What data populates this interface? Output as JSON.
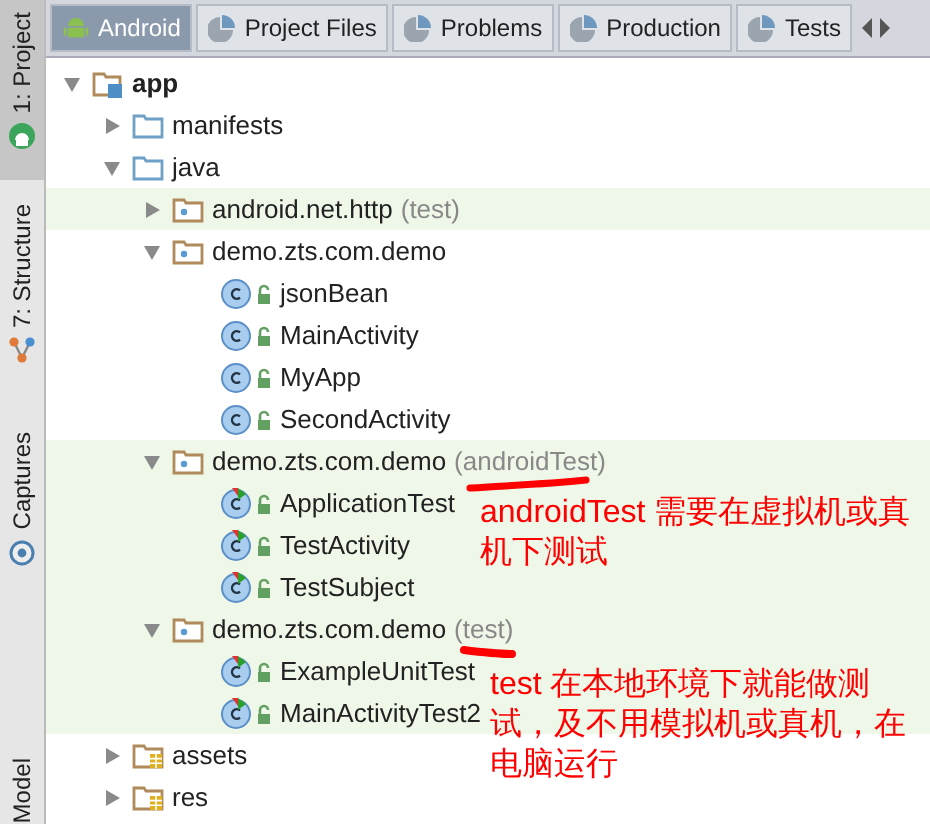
{
  "side_tools": [
    {
      "label": "1: Project",
      "selected": true
    },
    {
      "label": "7: Structure",
      "selected": false
    },
    {
      "label": "Captures",
      "selected": false
    },
    {
      "label": "Model",
      "selected": false
    }
  ],
  "tabs": [
    {
      "label": "Android",
      "selected": true
    },
    {
      "label": "Project Files",
      "selected": false
    },
    {
      "label": "Problems",
      "selected": false
    },
    {
      "label": "Production",
      "selected": false
    },
    {
      "label": "Tests",
      "selected": false
    }
  ],
  "tree": [
    {
      "label": "app",
      "kind": "module",
      "expanded": true,
      "children": [
        {
          "label": "manifests",
          "kind": "folder",
          "expanded": false
        },
        {
          "label": "java",
          "kind": "folder",
          "expanded": true,
          "children": [
            {
              "label": "android.net.http",
              "suffix": "(test)",
              "kind": "package",
              "expanded": false,
              "highlighted": true
            },
            {
              "label": "demo.zts.com.demo",
              "kind": "package",
              "expanded": true,
              "highlighted": false,
              "children": [
                {
                  "label": "jsonBean",
                  "kind": "class"
                },
                {
                  "label": "MainActivity",
                  "kind": "class"
                },
                {
                  "label": "MyApp",
                  "kind": "class"
                },
                {
                  "label": "SecondActivity",
                  "kind": "class"
                }
              ]
            },
            {
              "label": "demo.zts.com.demo",
              "suffix": "(androidTest)",
              "kind": "package",
              "expanded": true,
              "highlighted": true,
              "children": [
                {
                  "label": "ApplicationTest",
                  "kind": "test_class"
                },
                {
                  "label": "TestActivity",
                  "kind": "test_class"
                },
                {
                  "label": "TestSubject",
                  "kind": "test_class"
                }
              ]
            },
            {
              "label": "demo.zts.com.demo",
              "suffix": "(test)",
              "kind": "package",
              "expanded": true,
              "highlighted": true,
              "children": [
                {
                  "label": "ExampleUnitTest",
                  "kind": "test_class"
                },
                {
                  "label": "MainActivityTest2",
                  "kind": "test_class"
                }
              ]
            }
          ]
        },
        {
          "label": "assets",
          "kind": "res_folder",
          "expanded": false
        },
        {
          "label": "res",
          "kind": "res_folder",
          "expanded": false
        }
      ]
    }
  ],
  "annotations": [
    {
      "text": "androidTest 需要在虚拟机或真机下测试"
    },
    {
      "text": "test 在本地环境下就能做测试，及不用模拟机或真机，在电脑运行"
    }
  ]
}
